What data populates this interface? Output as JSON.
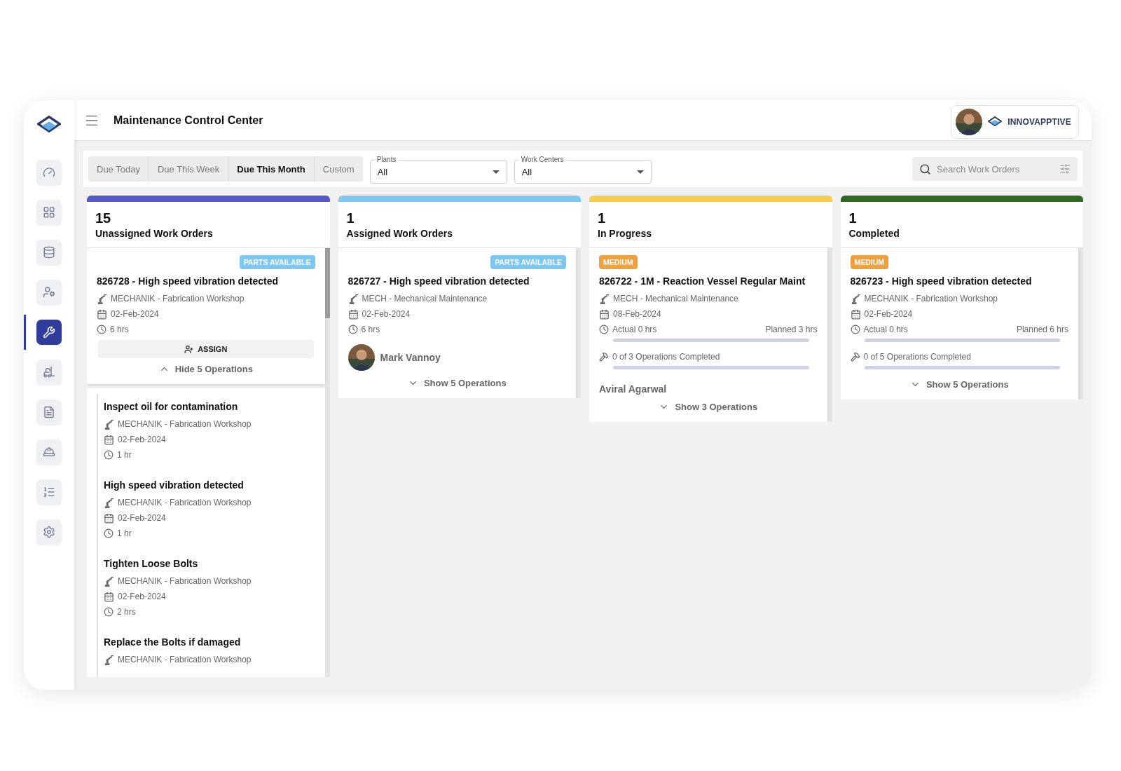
{
  "sidebar": {
    "items": [
      {
        "kind": "gauge",
        "selected": false
      },
      {
        "kind": "dashboard",
        "selected": false
      },
      {
        "kind": "database",
        "selected": false
      },
      {
        "kind": "user-settings",
        "selected": false
      },
      {
        "kind": "tools",
        "selected": true
      },
      {
        "kind": "forklift",
        "selected": false
      },
      {
        "kind": "document",
        "selected": false
      },
      {
        "kind": "helmet",
        "selected": false
      },
      {
        "kind": "list",
        "selected": false
      },
      {
        "kind": "settings",
        "selected": false
      }
    ]
  },
  "header": {
    "title": "Maintenance Control Center",
    "brand": "INNOVAPPTIVE"
  },
  "filters": {
    "date_tabs": [
      {
        "label": "Due Today",
        "selected": false
      },
      {
        "label": "Due This Week",
        "selected": false
      },
      {
        "label": "Due This Month",
        "selected": true
      },
      {
        "label": "Custom",
        "selected": false
      }
    ],
    "plants": {
      "label": "Plants",
      "value": "All"
    },
    "work_centers": {
      "label": "Work Centers",
      "value": "All"
    },
    "search": {
      "placeholder": "Search Work Orders"
    }
  },
  "columns": [
    {
      "count": "15",
      "title": "Unassigned Work Orders",
      "color": "#5558c8",
      "cards": [
        {
          "badge": {
            "text": "PARTS AVAILABLE",
            "kind": "parts"
          },
          "title": "826728 - High speed vibration detected",
          "work_center": "MECHANIK - Fabrication Workshop",
          "date": "02-Feb-2024",
          "duration": "6 hrs",
          "assign_button": "ASSIGN",
          "toggle": {
            "label": "Hide 5 Operations",
            "expanded": true
          },
          "operations": [
            {
              "title": "Inspect oil for contamination",
              "work_center": "MECHANIK - Fabrication Workshop",
              "date": "02-Feb-2024",
              "duration": "1 hr"
            },
            {
              "title": "High speed vibration detected",
              "work_center": "MECHANIK - Fabrication Workshop",
              "date": "02-Feb-2024",
              "duration": "1 hr"
            },
            {
              "title": "Tighten Loose Bolts",
              "work_center": "MECHANIK - Fabrication Workshop",
              "date": "02-Feb-2024",
              "duration": "2 hrs"
            },
            {
              "title": "Replace the Bolts if damaged",
              "work_center": "MECHANIK - Fabrication Workshop"
            }
          ]
        }
      ]
    },
    {
      "count": "1",
      "title": "Assigned Work Orders",
      "color": "#7cc8f2",
      "cards": [
        {
          "badge": {
            "text": "PARTS AVAILABLE",
            "kind": "parts"
          },
          "title": "826727 - High speed vibration detected",
          "work_center": "MECH - Mechanical Maintenance",
          "date": "02-Feb-2024",
          "duration": "6 hrs",
          "assignee": {
            "name": "Mark Vannoy",
            "avatar": true
          },
          "toggle": {
            "label": "Show 5 Operations",
            "expanded": false
          }
        }
      ]
    },
    {
      "count": "1",
      "title": "In Progress",
      "color": "#f8cd4a",
      "cards": [
        {
          "badge": {
            "text": "MEDIUM",
            "kind": "priority"
          },
          "title": "826722 - 1M - Reaction Vessel Regular Maint",
          "work_center": "MECH - Mechanical Maintenance",
          "date": "08-Feb-2024",
          "actual": "Actual 0 hrs",
          "planned": "Planned 3 hrs",
          "hours": {
            "level": 0
          },
          "operations_progress": {
            "text": "0 of 3 Operations Completed",
            "level": 0
          },
          "assignee": {
            "name": "Aviral Agarwal",
            "avatar": false
          },
          "toggle": {
            "label": "Show 3 Operations",
            "expanded": false
          }
        }
      ]
    },
    {
      "count": "1",
      "title": "Completed",
      "color": "#2e6b22",
      "cards": [
        {
          "badge": {
            "text": "MEDIUM",
            "kind": "priority"
          },
          "title": "826723 - High speed vibration detected",
          "work_center": "MECHANIK - Fabrication Workshop",
          "date": "02-Feb-2024",
          "actual": "Actual 0 hrs",
          "planned": "Planned 6 hrs",
          "hours": {
            "level": 0
          },
          "operations_progress": {
            "text": "0 of 5 Operations Completed",
            "level": 0
          },
          "toggle": {
            "label": "Show 5 Operations",
            "expanded": false
          }
        }
      ]
    }
  ]
}
